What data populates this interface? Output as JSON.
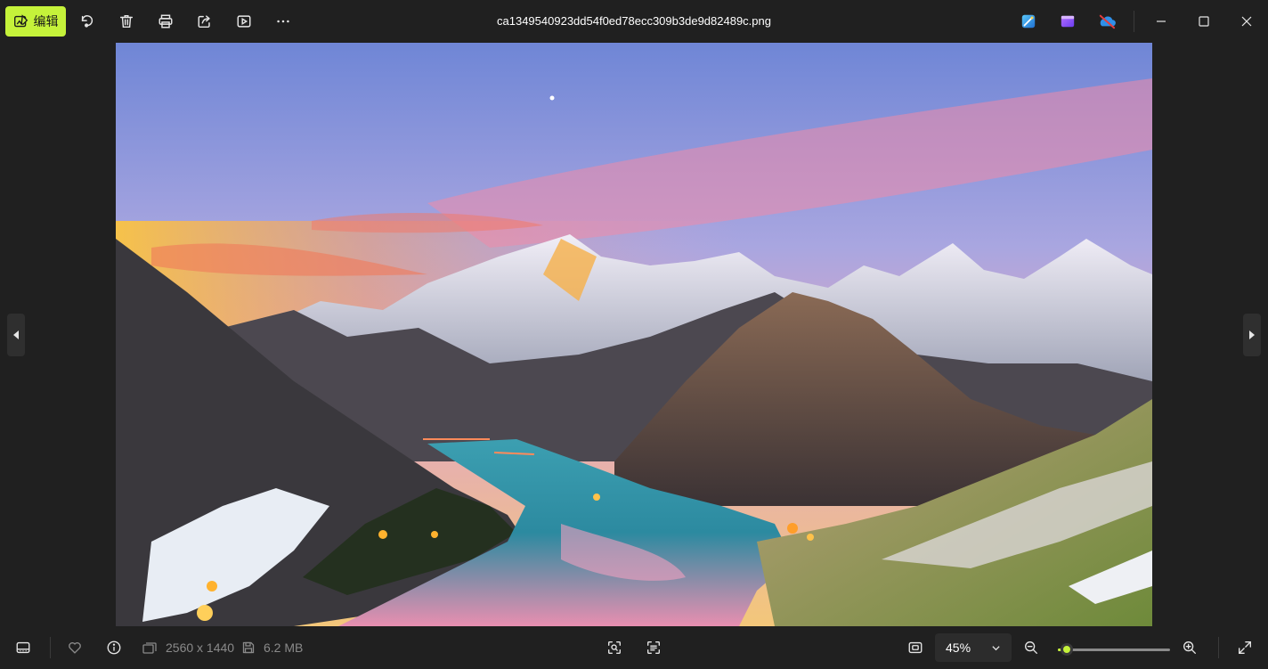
{
  "toolbar": {
    "edit_label": "编辑",
    "icons": [
      "rotate-icon",
      "delete-icon",
      "print-icon",
      "share-icon",
      "slideshow-icon",
      "more-icon"
    ]
  },
  "window": {
    "title": "ca1349540923dd54f0ed78ecc309b3de9d82489c.png",
    "apps": [
      "designer-app-icon",
      "clipchamp-app-icon",
      "onedrive-icon"
    ]
  },
  "info": {
    "dimensions": "2560 x 1440",
    "file_size": "6.2 MB"
  },
  "zoom": {
    "value_label": "45%",
    "level_fraction": 0.08
  },
  "colors": {
    "accent": "#c5f23a",
    "background": "#202020"
  }
}
